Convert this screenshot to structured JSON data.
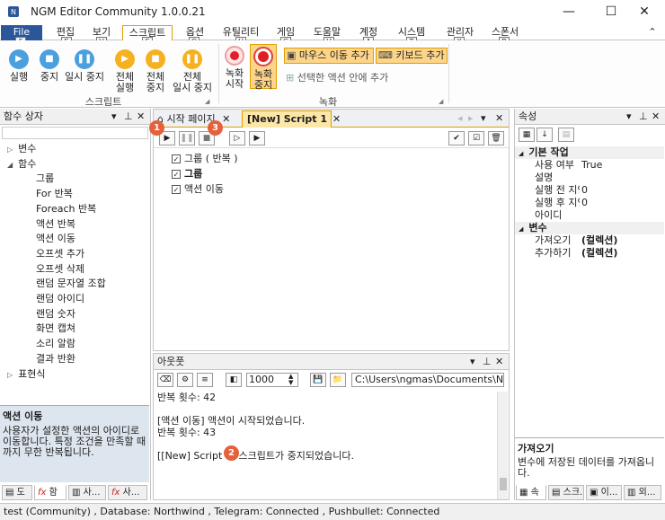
{
  "window": {
    "title": "NGM Editor  Community 1.0.0.21",
    "min": "—",
    "max": "☐",
    "close": "✕"
  },
  "menu": {
    "file": "File",
    "tabs": [
      "편집",
      "보기",
      "스크립트",
      "옵션",
      "유틸리티",
      "게임",
      "도움말",
      "계정",
      "시스템",
      "관리자",
      "스폰서"
    ],
    "keys": [
      "F",
      "E",
      "V",
      "S",
      "O",
      "U",
      "G",
      "H",
      "A",
      "T",
      "X",
      "R"
    ],
    "collapse": "⌃"
  },
  "ribbon": {
    "script_group": {
      "label": "스크립트",
      "buttons": [
        "실행",
        "중지",
        "일시 중지"
      ],
      "all_run": [
        "전체",
        "실행"
      ],
      "all_stop": [
        "전체",
        "중지"
      ],
      "all_pause": [
        "전체",
        "일시 중지"
      ]
    },
    "record_group": {
      "label": "녹화",
      "record_start": [
        "녹화",
        "시작"
      ],
      "record_stop": [
        "녹화",
        "중지"
      ],
      "add_mouse": "마우스 이동 추가",
      "add_keyboard": "키보드 추가",
      "add_into_selected": "선택한 액션 안에 추가"
    }
  },
  "left_panel": {
    "title": "함수 상자",
    "tree": [
      {
        "label": "변수",
        "level": 0,
        "expander": "▷"
      },
      {
        "label": "함수",
        "level": 0,
        "expander": "◢"
      },
      {
        "label": "그룹",
        "level": 1
      },
      {
        "label": "For 반복",
        "level": 1
      },
      {
        "label": "Foreach 반복",
        "level": 1
      },
      {
        "label": "액션 반복",
        "level": 1
      },
      {
        "label": "액션 이동",
        "level": 1
      },
      {
        "label": "오프셋 추가",
        "level": 1
      },
      {
        "label": "오프셋 삭제",
        "level": 1
      },
      {
        "label": "랜덤 문자열 조합",
        "level": 1
      },
      {
        "label": "랜덤 아이디",
        "level": 1
      },
      {
        "label": "랜덤 숫자",
        "level": 1
      },
      {
        "label": "화면 캡쳐",
        "level": 1
      },
      {
        "label": "소리 알람",
        "level": 1
      },
      {
        "label": "결과 반환",
        "level": 1
      },
      {
        "label": "표현식",
        "level": 0,
        "expander": "▷"
      }
    ],
    "desc_title": "액션 이동",
    "desc_text": "사용자가 설정한 액션의 아이디로 이동합니다. 특정 조건을 만족할 때까지 무한 반복됩니다.",
    "bottom_tabs": [
      "도",
      "함",
      "사...",
      "사..."
    ]
  },
  "editor": {
    "tabs": [
      {
        "label": "시작 페이지",
        "active": false
      },
      {
        "label": "[New] Script 1",
        "active": true
      }
    ],
    "lines": [
      {
        "label": "그룹 ( 반복 )",
        "bold": false
      },
      {
        "label": "그룹",
        "bold": true
      },
      {
        "label": "액션 이동",
        "bold": false
      }
    ],
    "badges": [
      "1",
      "3"
    ]
  },
  "output": {
    "title": "아웃풋",
    "count_value": "1000",
    "path": "C:\\Users\\ngmas\\Documents\\NGM5\\",
    "lines": [
      "반복 횟수: 42",
      "",
      "[액션 이동] 액션이 시작되었습니다.",
      "반복 횟수: 43",
      "",
      "[[New] Script 1] 스크립트가 중지되었습니다."
    ],
    "badge": "2"
  },
  "properties": {
    "title": "속성",
    "groups": [
      {
        "name": "기본 작업",
        "rows": [
          [
            "사용 여부",
            "True"
          ],
          [
            "설명",
            ""
          ],
          [
            "실행 전 지연",
            "0"
          ],
          [
            "실행 후 지연",
            "0"
          ],
          [
            "아이디",
            ""
          ]
        ]
      },
      {
        "name": "변수",
        "rows": [
          [
            "가져오기",
            "(컬렉션)"
          ],
          [
            "추가하기",
            "(컬렉션)"
          ]
        ]
      }
    ],
    "desc_title": "가져오기",
    "desc_text": "변수에 저장된 데이터를 가져옵니다.",
    "bottom_tabs": [
      "속",
      "스크...",
      "이...",
      "외..."
    ]
  },
  "status": "test (Community)  , Database: Northwind  , Telegram: Connected  , Pushbullet: Connected"
}
